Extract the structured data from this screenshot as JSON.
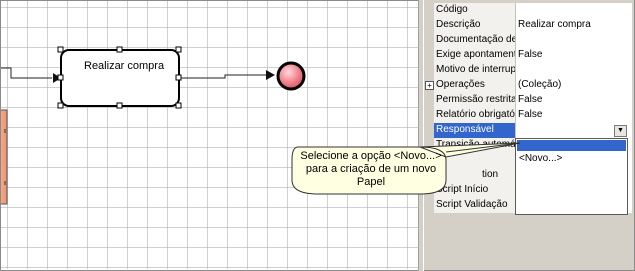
{
  "diagram": {
    "task_label": "Realizar compra"
  },
  "properties": {
    "rows": [
      {
        "name": "Código",
        "value": ""
      },
      {
        "name": "Descrição",
        "value": "Realizar compra"
      },
      {
        "name": "Documentação de",
        "value": ""
      },
      {
        "name": "Exige apontamento",
        "value": "False"
      },
      {
        "name": "Motivo de interrup",
        "value": ""
      },
      {
        "name": "Operações",
        "value": "(Coleção)"
      },
      {
        "name": "Permissão restrita",
        "value": "False"
      },
      {
        "name": "Relatório obrigatór",
        "value": "False"
      },
      {
        "name": "Responsável",
        "value": ""
      },
      {
        "name": "Transição automát",
        "value": ""
      },
      {
        "name": "",
        "value": ""
      },
      {
        "name": "tion",
        "value": ""
      },
      {
        "name": "Script Início",
        "value": ""
      },
      {
        "name": "Script Validação",
        "value": ""
      }
    ],
    "expand_symbol": "+"
  },
  "dropdown": {
    "arrow": "▼",
    "option": "<Novo...>"
  },
  "callout": {
    "text": "Selecione a opção <Novo...> para a criação de um novo Papel"
  },
  "colors": {
    "selection": "#3366cc",
    "callout_fill": "#ffffe1",
    "end_event_fill": "#f07f8a",
    "side_shape_fill": "#f5a98c"
  }
}
